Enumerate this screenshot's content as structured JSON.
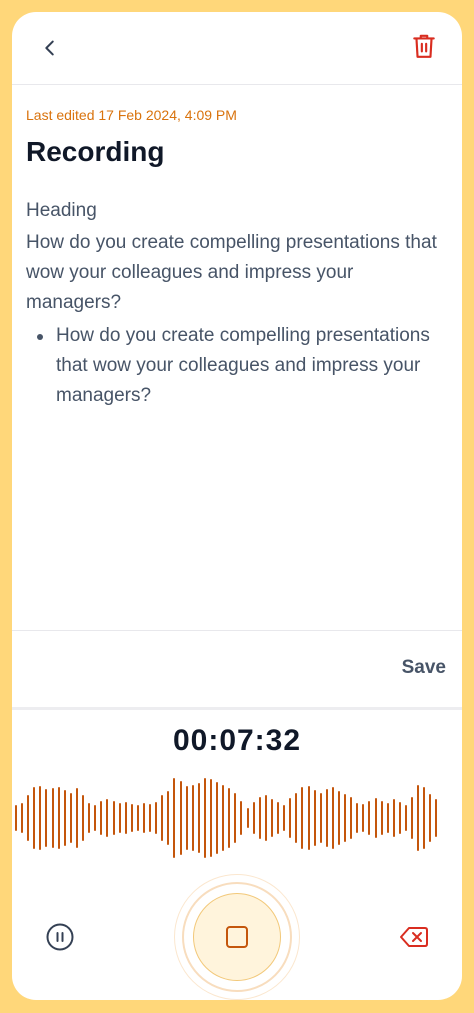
{
  "header": {
    "back_icon": "chevron-left-icon",
    "delete_icon": "trash-icon",
    "delete_color": "#D92D20"
  },
  "note": {
    "last_edited": "Last edited 17 Feb 2024, 4:09 PM",
    "title": "Recording",
    "heading": "Heading",
    "paragraph": "How do you create compelling presentations that wow your colleagues and impress your managers?",
    "bullets": [
      "How do you create compelling presentations that wow your colleagues and impress your managers?"
    ]
  },
  "actions": {
    "save_label": "Save"
  },
  "recorder": {
    "timer": "00:07:32",
    "wave_color": "#C4560C",
    "pause_icon": "pause-circle-icon",
    "stop_icon": "stop-icon",
    "discard_icon": "backspace-x-icon",
    "discard_color": "#D92D20"
  }
}
